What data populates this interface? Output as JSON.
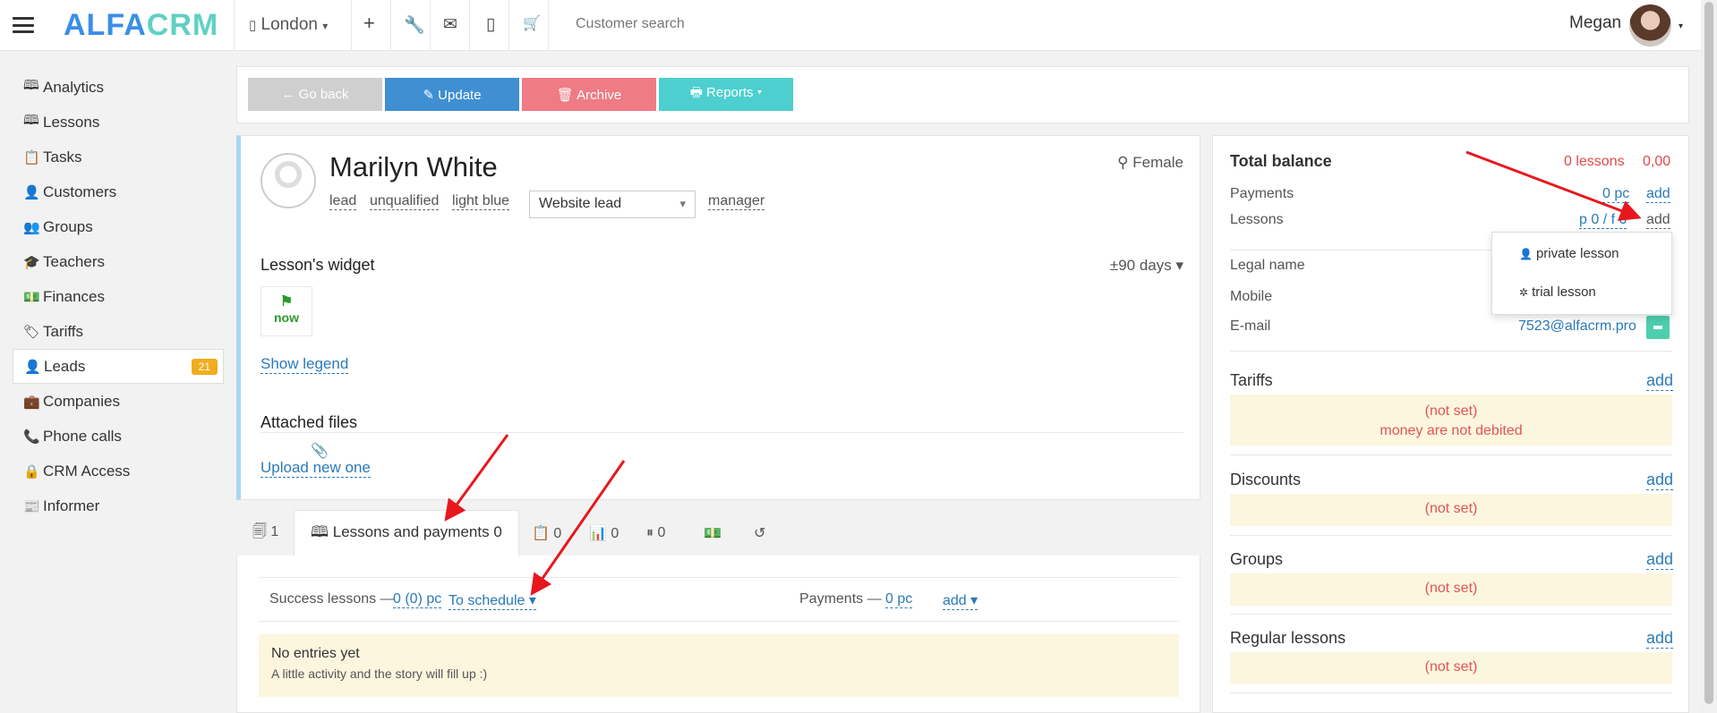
{
  "topbar": {
    "logo_part1": "ALFA",
    "logo_part2": "CRM",
    "city": "London",
    "city_caret": "▾",
    "search_placeholder": "Customer search",
    "user_name": "Megan",
    "user_caret": "▾"
  },
  "sidebar": {
    "items": [
      {
        "label": "Analytics",
        "icon": "🕮"
      },
      {
        "label": "Lessons",
        "icon": "🕮"
      },
      {
        "label": "Tasks",
        "icon": "📋"
      },
      {
        "label": "Customers",
        "icon": "👤"
      },
      {
        "label": "Groups",
        "icon": "👥"
      },
      {
        "label": "Teachers",
        "icon": "🎓"
      },
      {
        "label": "Finances",
        "icon": "💵"
      },
      {
        "label": "Tariffs",
        "icon": "🏷"
      },
      {
        "label": "Leads",
        "icon": "👤",
        "badge": "21"
      },
      {
        "label": "Companies",
        "icon": "💼"
      },
      {
        "label": "Phone calls",
        "icon": "📞"
      },
      {
        "label": "CRM Access",
        "icon": "🔒"
      },
      {
        "label": "Informer",
        "icon": "📰"
      }
    ]
  },
  "actions": {
    "go_back": "← Go back",
    "update": "✎ Update",
    "archive": "🗑 Archive",
    "reports": "🖶 Reports ▾"
  },
  "profile": {
    "name": "Marilyn White",
    "gender": "⚲ Female",
    "tags": [
      "lead",
      "unqualified",
      "light blue"
    ],
    "source": "Website lead",
    "manager": "manager",
    "widget_title": "Lesson's widget",
    "widget_range": "±90 days ▾",
    "now_flag": "⚑",
    "now_label": "now",
    "show_legend": "Show legend",
    "files_title": "Attached files",
    "clip": "📎",
    "upload": "Upload new one"
  },
  "tabs": {
    "t1": "🗐 1",
    "lessons": "🕮 Lessons and payments 0",
    "t3": "📋 0",
    "t4": "📊 0",
    "t5": "⏸ 0",
    "t6": "💵",
    "t7": "↺"
  },
  "lessons": {
    "success_label": "Success lessons —",
    "success_value": "0 (0) pc",
    "schedule": "To schedule ▾",
    "payments_label": "Payments —",
    "payments_value": "0 pc",
    "payments_add": "add ▾",
    "empty_title": "No entries yet",
    "empty_sub": "A little activity and the story will fill up :)"
  },
  "right_panel": {
    "total_balance": "Total balance",
    "balance_lessons": "0 lessons",
    "balance_money": "0,00",
    "payments_label": "Payments",
    "payments_value": "0 pc",
    "payments_add": "add",
    "lessons_label": "Lessons",
    "lessons_value": "p 0 / f 0",
    "lessons_add": "add",
    "legal_name": "Legal name",
    "mobile": "Mobile",
    "email_label": "E-mail",
    "email_value": "7523@alfacrm.pro",
    "tariffs": "Tariffs",
    "tariffs_add": "add",
    "tariffs_notset": "(not set)",
    "tariffs_note": "money are not debited",
    "discounts": "Discounts",
    "discounts_add": "add",
    "discounts_notset": "(not set)",
    "groups": "Groups",
    "groups_add": "add",
    "groups_notset": "(not set)",
    "regular": "Regular lessons",
    "regular_add": "add",
    "regular_notset": "(not set)"
  },
  "dropdown": {
    "private": "private lesson",
    "private_icon": "👤",
    "trial": "trial lesson",
    "trial_icon": "✲"
  },
  "colors": {
    "blue_button": "#3f8fd2",
    "red_button": "#ef7b84",
    "teal_button": "#4dcfcf",
    "gray_button": "#cfcfcf",
    "arrow": "#e8171e",
    "badge": "#f0ad1e"
  }
}
